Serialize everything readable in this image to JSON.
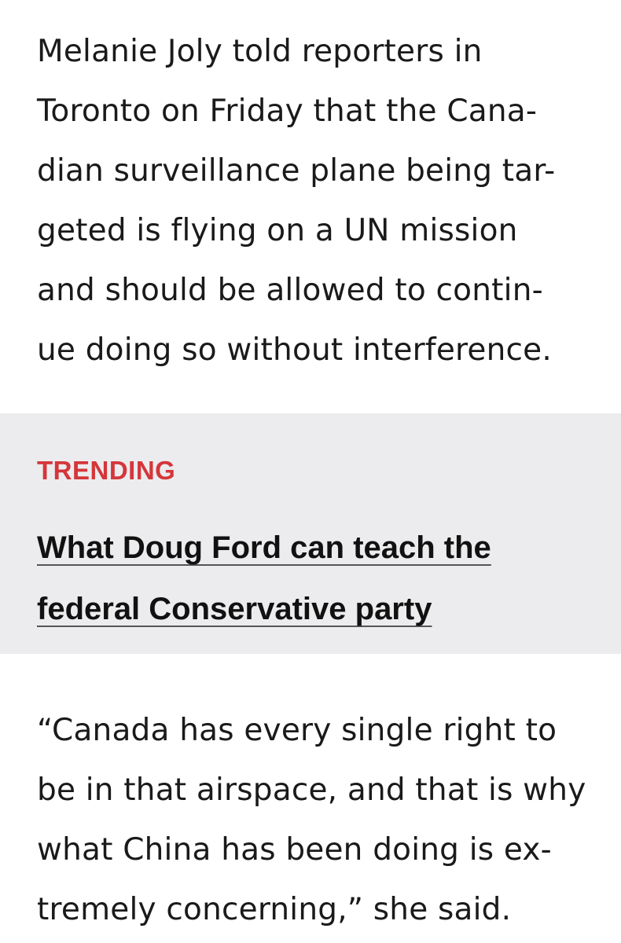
{
  "article": {
    "paragraph_1": [
      "Melanie Joly told reporters in",
      "Toronto on Friday that the Cana-",
      "dian surveillance plane being tar-",
      "geted is flying on a UN mission",
      "and should be allowed to contin-",
      "ue doing so without interference."
    ],
    "paragraph_2": [
      "“Canada has every single right to",
      "be in that airspace, and that is why",
      "what China has been doing is ex-",
      "tremely concerning,” she said."
    ]
  },
  "trending": {
    "label": "TRENDING",
    "headline_lines": [
      "What Doug Ford can teach the",
      "federal Conservative party"
    ]
  },
  "colors": {
    "trending_label": "#d4363a",
    "trending_background": "#ececee",
    "body_text": "#1a1a1a"
  }
}
